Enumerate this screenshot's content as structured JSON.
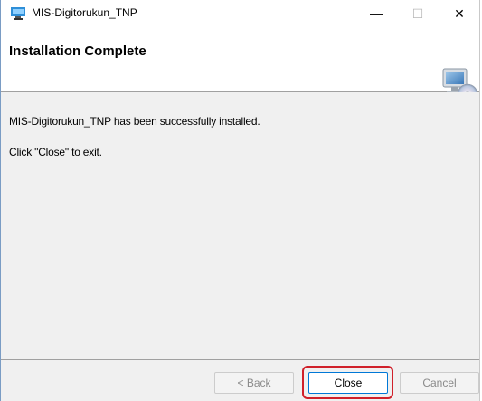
{
  "window": {
    "title": "MIS-Digitorukun_TNP",
    "controls": {
      "minimize": "—",
      "maximize": "☐",
      "close": "✕"
    }
  },
  "header": {
    "title": "Installation Complete",
    "icon": "computer-cd-icon"
  },
  "content": {
    "message": "MIS-Digitorukun_TNP has been successfully installed.",
    "instruction": "Click \"Close\" to exit."
  },
  "buttons": {
    "back": "< Back",
    "close": "Close",
    "cancel": "Cancel"
  },
  "colors": {
    "highlight": "#d0202a",
    "focus_border": "#0078d7",
    "window_bg": "#f0f0f0"
  }
}
